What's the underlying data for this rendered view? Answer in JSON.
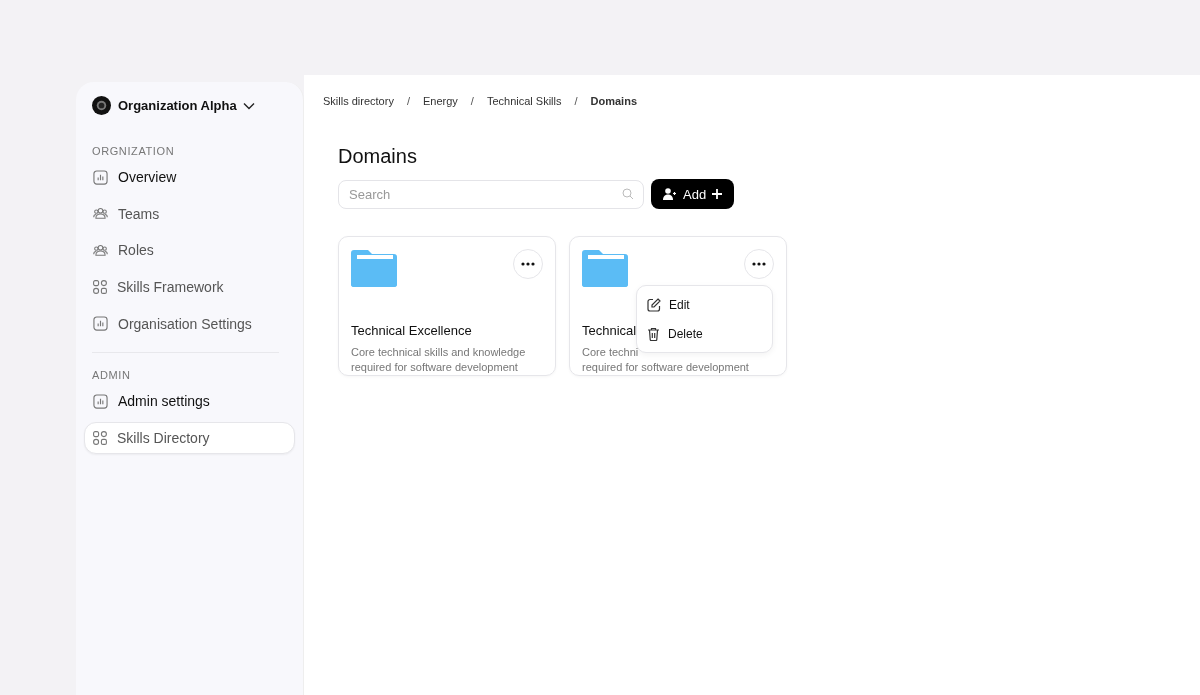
{
  "sidebar": {
    "org_name": "Organization Alpha",
    "sections": [
      {
        "title": "ORGNIZATION",
        "items": [
          {
            "label": "Overview",
            "kind": "chart",
            "selected": false
          },
          {
            "label": "Teams",
            "kind": "people",
            "selected": false
          },
          {
            "label": "Roles",
            "kind": "people",
            "selected": false
          },
          {
            "label": "Skills Framework",
            "kind": "grid",
            "selected": false
          },
          {
            "label": "Organisation Settings",
            "kind": "chart",
            "selected": false
          }
        ]
      },
      {
        "title": "ADMIN",
        "items": [
          {
            "label": "Admin settings",
            "kind": "chart",
            "selected": false
          },
          {
            "label": "Skills Directory",
            "kind": "grid",
            "selected": true
          }
        ]
      }
    ]
  },
  "breadcrumb": [
    {
      "label": "Skills directory",
      "current": false
    },
    {
      "label": "Energy",
      "current": false
    },
    {
      "label": "Technical Skills",
      "current": false
    },
    {
      "label": "Domains",
      "current": true
    }
  ],
  "breadcrumb_separator": "/",
  "page_title": "Domains",
  "search": {
    "placeholder": "Search"
  },
  "add_button": {
    "label": "Add"
  },
  "cards": [
    {
      "title": "Technical Excellence",
      "description": [
        "Core technical skills and knowledge",
        "required for software development"
      ],
      "menu_open": false
    },
    {
      "title": "Technical",
      "description": [
        "Core techni",
        "required for software development"
      ],
      "menu_open": true
    }
  ],
  "card_menu": [
    {
      "label": "Edit",
      "kind": "edit"
    },
    {
      "label": "Delete",
      "kind": "delete"
    }
  ]
}
